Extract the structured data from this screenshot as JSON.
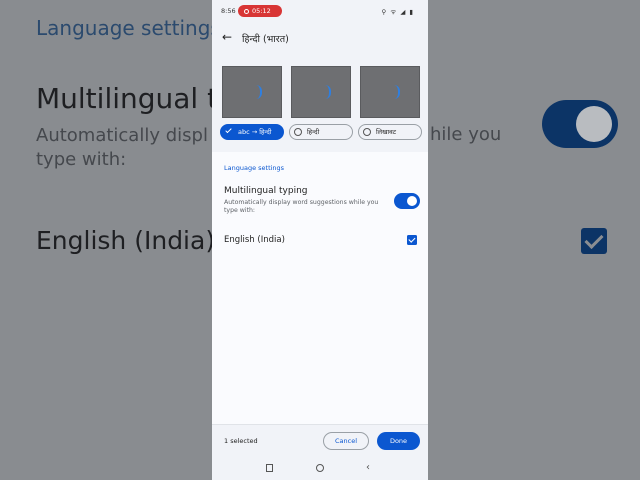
{
  "background": {
    "section_title": "Language settings",
    "heading": "Multilingual ty",
    "description": "Automatically displ",
    "description_line2": "type with:",
    "description_right": "hile you",
    "language": "English (India)"
  },
  "status_bar": {
    "time": "8:56",
    "recording_time": "05:12",
    "icons_text": "⚲ ᯤ ◢ ▮"
  },
  "app_bar": {
    "back_icon": "arrow-left",
    "title": "हिन्दी (भारत)"
  },
  "layouts": {
    "options": [
      {
        "label": "abc → हिन्दी",
        "selected": true
      },
      {
        "label": "हिन्दी",
        "selected": false
      },
      {
        "label": "लिखावट",
        "selected": false
      }
    ]
  },
  "settings": {
    "section_title": "Language settings",
    "multilingual_title": "Multilingual typing",
    "multilingual_desc": "Automatically display word suggestions while you type with:",
    "multilingual_enabled": true,
    "language_label": "English (India)",
    "language_checked": true
  },
  "bottom_bar": {
    "selected_count": "1 selected",
    "cancel_label": "Cancel",
    "done_label": "Done"
  },
  "colors": {
    "accent": "#0b57d0",
    "recording": "#d83535"
  }
}
